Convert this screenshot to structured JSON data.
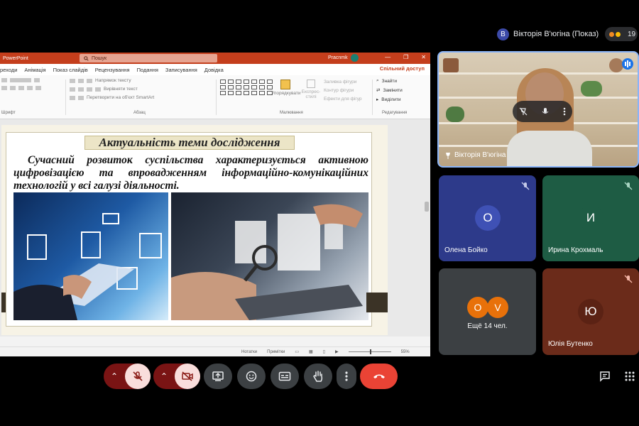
{
  "presenter": {
    "initial": "В",
    "label": "Вікторія В'югіна (Показ)",
    "count": "19"
  },
  "ppt": {
    "app_name": "PowerPoint",
    "search_placeholder": "Пошук",
    "user_label": "Pracnmk",
    "share": "Спільний доступ",
    "menu": [
      "реходи",
      "Анімація",
      "Показ слайдів",
      "Рецензування",
      "Подання",
      "Записування",
      "Довідка"
    ],
    "ribbon": {
      "group_font": "Шрифт",
      "group_paragraph": "Абзац",
      "group_drawing": "Малювання",
      "group_editing": "Редагування",
      "para_dir": "Напрямок тексту",
      "para_align": "Вирівняти текст",
      "para_smart": "Перетворити на об'єкт SmartArt",
      "arrange": "Упорядкувати",
      "quick_styles": "Експрес-стилі",
      "fill": "Заливка фігури",
      "outline": "Контур фігури",
      "effects": "Ефекти для фігур",
      "find": "Знайти",
      "replace": "Замінити",
      "select": "Виділити"
    },
    "status": {
      "notes": "Нотатки",
      "comments": "Примітки",
      "zoom": "55%"
    }
  },
  "slide": {
    "title": "Актуальність теми дослідження",
    "body": "Сучасний розвиток суспільства характеризується активною цифровізацією та впровадженням інформаційно-комунікаційних технологій у всі галузі діяльності."
  },
  "tiles": {
    "main": {
      "name": "Вікторія В'югіна"
    },
    "olena": {
      "initial": "О",
      "name": "Олена Бойко",
      "color": "#2d3a8a"
    },
    "iryna": {
      "initial": "И",
      "name": "Ирина Крохмаль",
      "color": "#1e5c44"
    },
    "more": {
      "a": "O",
      "b": "V",
      "label": "Ещё 14 чел."
    },
    "yulia": {
      "initial": "Ю",
      "name": "Юлія Бутенко",
      "color": "#6b2b1a"
    }
  },
  "colors": {
    "accent": "#8ab4f8",
    "end_call": "#ea4335",
    "muted_bg": "#f9dedc",
    "ppt_brand": "#c43e1c"
  },
  "icons": [
    "mic-off-icon",
    "camera-off-icon",
    "present-icon",
    "emoji-icon",
    "captions-icon",
    "raise-hand-icon",
    "more-icon",
    "end-call-icon",
    "chat-icon",
    "apps-icon"
  ]
}
